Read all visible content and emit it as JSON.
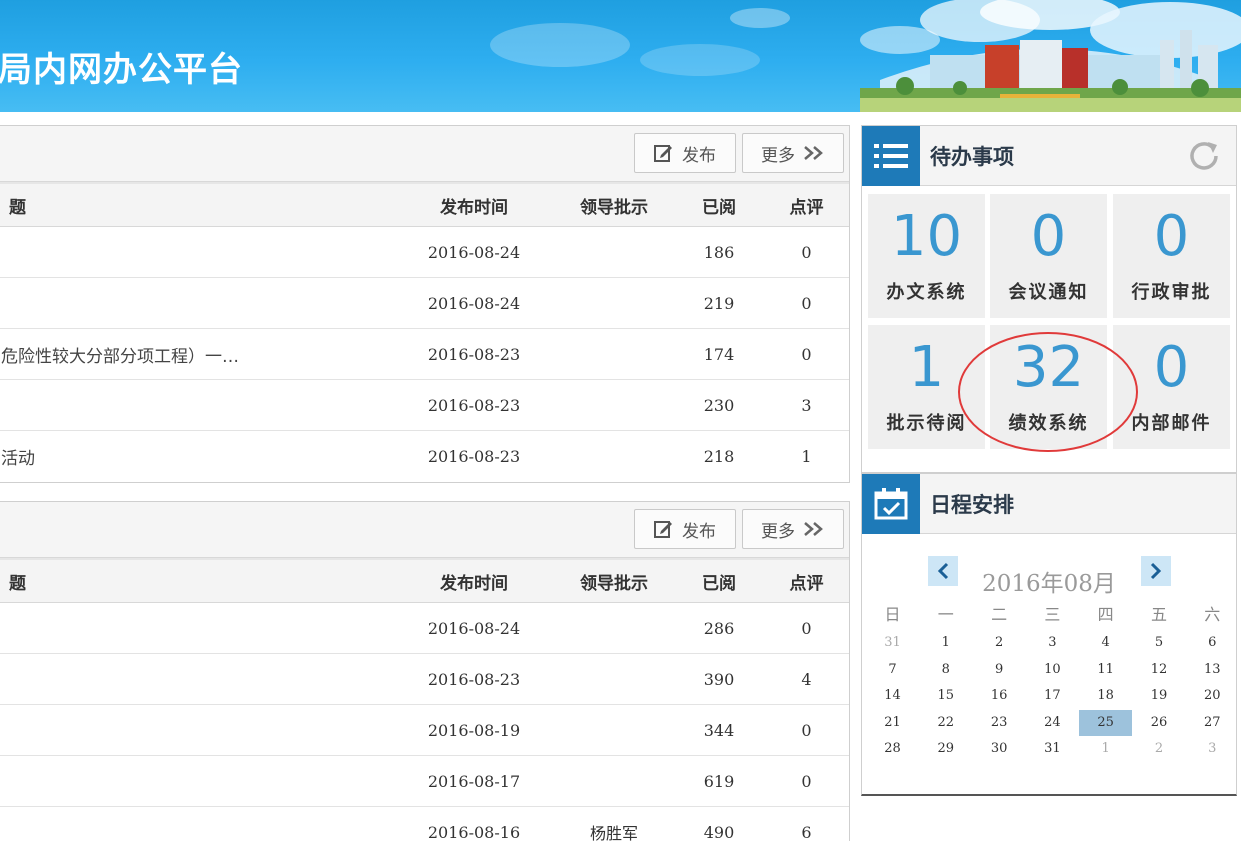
{
  "header": {
    "title": "局内网办公平台"
  },
  "panels": [
    {
      "publish_label": "发布",
      "more_label": "更多",
      "columns": {
        "title": "题",
        "date": "发布时间",
        "leader": "领导批示",
        "read": "已阅",
        "comment": "点评"
      },
      "rows": [
        {
          "title": "",
          "date": "2016-08-24",
          "leader": "",
          "read": "186",
          "comment": "0"
        },
        {
          "title": "",
          "date": "2016-08-24",
          "leader": "",
          "read": "219",
          "comment": "0"
        },
        {
          "title": "危险性较大分部分项工程）一…",
          "date": "2016-08-23",
          "leader": "",
          "read": "174",
          "comment": "0"
        },
        {
          "title": "",
          "date": "2016-08-23",
          "leader": "",
          "read": "230",
          "comment": "3"
        },
        {
          "title": "活动",
          "date": "2016-08-23",
          "leader": "",
          "read": "218",
          "comment": "1"
        }
      ]
    },
    {
      "publish_label": "发布",
      "more_label": "更多",
      "columns": {
        "title": "题",
        "date": "发布时间",
        "leader": "领导批示",
        "read": "已阅",
        "comment": "点评"
      },
      "rows": [
        {
          "title": "",
          "date": "2016-08-24",
          "leader": "",
          "read": "286",
          "comment": "0"
        },
        {
          "title": "",
          "date": "2016-08-23",
          "leader": "",
          "read": "390",
          "comment": "4"
        },
        {
          "title": "",
          "date": "2016-08-19",
          "leader": "",
          "read": "344",
          "comment": "0"
        },
        {
          "title": "",
          "date": "2016-08-17",
          "leader": "",
          "read": "619",
          "comment": "0"
        },
        {
          "title": "",
          "date": "2016-08-16",
          "leader": "杨胜军",
          "read": "490",
          "comment": "6"
        }
      ]
    }
  ],
  "todo": {
    "title": "待办事项",
    "tiles": [
      {
        "count": "10",
        "label": "办文系统"
      },
      {
        "count": "0",
        "label": "会议通知"
      },
      {
        "count": "0",
        "label": "行政审批"
      },
      {
        "count": "1",
        "label": "批示待阅"
      },
      {
        "count": "32",
        "label": "绩效系统"
      },
      {
        "count": "0",
        "label": "内部邮件"
      }
    ],
    "highlight_tile": "绩效系统",
    "highlight_color": "#e03a3a"
  },
  "schedule": {
    "title": "日程安排",
    "month_label": "2016年08月",
    "weekdays": [
      "日",
      "一",
      "二",
      "三",
      "四",
      "五",
      "六"
    ],
    "weeks": [
      [
        "31",
        "1",
        "2",
        "3",
        "4",
        "5",
        "6"
      ],
      [
        "7",
        "8",
        "9",
        "10",
        "11",
        "12",
        "13"
      ],
      [
        "14",
        "15",
        "16",
        "17",
        "18",
        "19",
        "20"
      ],
      [
        "21",
        "22",
        "23",
        "24",
        "25",
        "26",
        "27"
      ],
      [
        "28",
        "29",
        "30",
        "31",
        "1",
        "2",
        "3"
      ]
    ],
    "today": "25"
  },
  "colors": {
    "accent": "#3a97d0",
    "icon_box": "#1e7ab8",
    "header": "#2eaef0"
  },
  "icons": [
    "edit-icon",
    "double-chevron-right-icon",
    "list-icon",
    "refresh-icon",
    "calendar-check-icon",
    "chevron-left-icon",
    "chevron-right-icon"
  ]
}
